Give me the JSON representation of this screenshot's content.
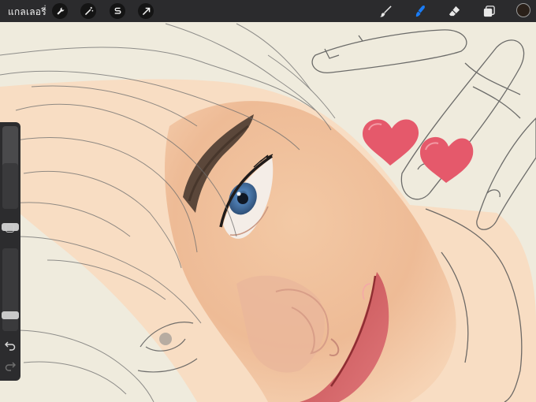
{
  "toolbar": {
    "gallery_label": "แกลเลอรี่",
    "left_tools": [
      "wrench-icon",
      "magic-wand-icon",
      "selection-icon",
      "transform-arrow-icon"
    ],
    "right_tools": [
      "brush-icon",
      "smudge-icon",
      "eraser-icon",
      "layers-icon"
    ],
    "active_tool": "smudge-icon",
    "active_color": "#2a2019",
    "accent_color": "#1a7cf5"
  },
  "sidebar": {
    "brush_size_level": 0.55,
    "opacity_level": 1.0,
    "icons": [
      "modify-square-icon",
      "undo-icon",
      "redo-icon"
    ]
  },
  "stickers": [
    "heart-icon",
    "heart-icon"
  ]
}
